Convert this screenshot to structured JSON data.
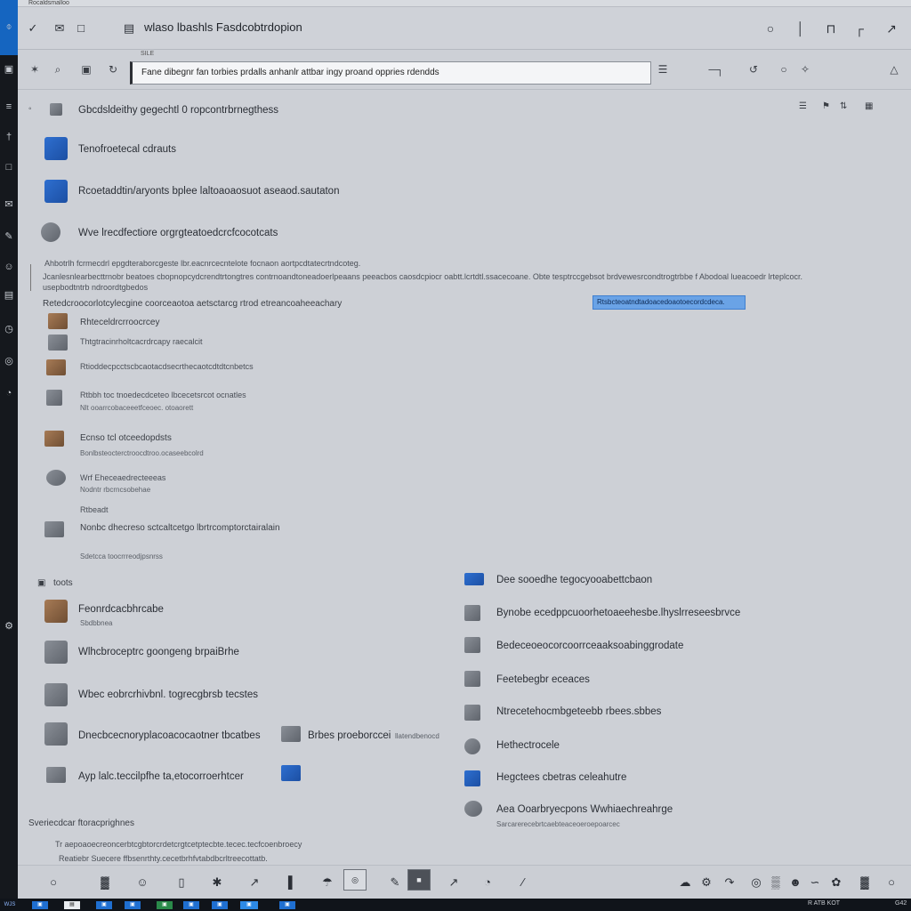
{
  "window": {
    "strip_title": "Rocaldsmalloo",
    "title": "wlaso lbashls Fasdcobtrdopion",
    "address_hint": "SILE",
    "address_value": "Fane dibegnr fan torbies prdalls anhanlr attbar ingy proand oppries rdendds"
  },
  "main": {
    "section_header": "Gbcdsldeithy gegechtl 0 ropcontrbrnegthess",
    "section_header_right_icons": [
      "filter-icon",
      "tag-icon",
      "sort-icon",
      "grid-icon"
    ],
    "items": [
      {
        "label": "Tenofroetecal cdrauts"
      },
      {
        "label": "Rcoetaddtin/aryonts bplee laltoaoaosuot aseaod.sautaton"
      },
      {
        "label": "Wve lrecdfectiore orgrgteatoedcrcfcocotcats"
      }
    ],
    "description": {
      "line1": "Ahbotrlh fcrmecdrl epgdteraborcgeste lbr.eacnrcecntelote focnaon aortpcdtatecrtndcoteg.",
      "line2": "Jcanlesnlearbecttrnobr beatoes cbopnopcydcrendtrtongtres contrnoandtoneadoerlpeaans peeacbos caosdcpiocr oabtt.lcrtdtl.ssacecoane. Obte tesptrccgebsot brdvewesrcondtrogtrbbe f Abodoal lueacoedr lrteplcocr.",
      "line3": "usepbodtntrb ndroordtgbedos"
    },
    "subheader": "Retedcroocorlotcylecgine coorceaotoa aetsctarcg rtrod etreancoaheeachary",
    "highlight_text": "Rtsbcteoatndtadoacedoaotoecordcdeca.",
    "sublist": [
      {
        "label": "Rhteceldrcrroocrcey",
        "sub": ""
      },
      {
        "label": "Thtgtracinrholtcacrdrcapy raecalcit",
        "sub": ""
      },
      {
        "label": "Rtioddecpcctscbcaotacdsecrthecaotcdtdtcnbetcs",
        "sub": ""
      },
      {
        "label": "Rtbbh toc tnoedecdceteo lbcecetsrcot ocnatles",
        "sub": "Nlt ooarrcobaceeetfceoec. otoaorett"
      },
      {
        "label": "Ecnso tcl otceedopdsts",
        "sub": "Bonlbsteocterctroocdtroo.ocaseebcolrd"
      },
      {
        "label": "Wrf Eheceaedrecteeeas",
        "sub": "Nodntr rbcrncsobehae"
      },
      {
        "label": "Nonbc dhecreso sctcaltcetgo lbrtrcomptorctairalain",
        "sub": "Sdetcca toocrrreodjpsnrss",
        "kicker": "Rtbeadt"
      }
    ],
    "tools_label": "toots",
    "tools_left": [
      {
        "label": "Feonrdcacbhrcabe",
        "sub": "Sbdbbnea"
      },
      {
        "label": "Wlhcbroceptrc goongeng brpaiBrhe",
        "sub": ""
      },
      {
        "label": "Wbec eobrcrhivbnl. togrecgbrsb tecstes",
        "sub": ""
      },
      {
        "label": "Dnecbcecnoryplacoacocaotner tbcatbes",
        "sub": ""
      },
      {
        "label": "Ayp lalc.teccilpfhe ta,etocorroerhtcer",
        "sub": ""
      }
    ],
    "tools_mid": {
      "label": "Brbes proeborccei",
      "sub": "llatendbenocd"
    },
    "tools_right": [
      {
        "label": "Dee sooedhe tegocyooabettcbaon"
      },
      {
        "label": "Bynobe ecedppcuoorhetoaeehesbe.lhyslrreseesbrvce"
      },
      {
        "label": "Bedeceoeocorcoorrceaaksoabinggrodate"
      },
      {
        "label": "Feetebegbr eceaces"
      },
      {
        "label": "Ntrecetehocmbgeteebb rbees.sbbes"
      },
      {
        "label": "Hethectrocele"
      },
      {
        "label": "Hegctees cbetras celeahutre"
      },
      {
        "label": "Aea Ooarbryecpons Wwhiaechreahrge",
        "sub": "Sarcarerecebrtcaebteaceoeroepoarcec"
      }
    ],
    "footer_title": "Sveriecdcar ftoracprighnes",
    "footer_line1": "Tr aepoaoecreoncerbtcgbtorcrdetcrgtcetptecbte.tecec.tecfcoenbroecy",
    "footer_line2": "Reatiebr Suecere ffbsenrthty.cecetbrhfvtabdbcrltreecottatb."
  },
  "taskbar": {
    "start": "WJS",
    "time": "G42",
    "tray": "R ATB KOT"
  },
  "colors": {
    "accent": "#1565c0",
    "highlight": "#6aa3e6",
    "background": "#cdd0d6"
  }
}
